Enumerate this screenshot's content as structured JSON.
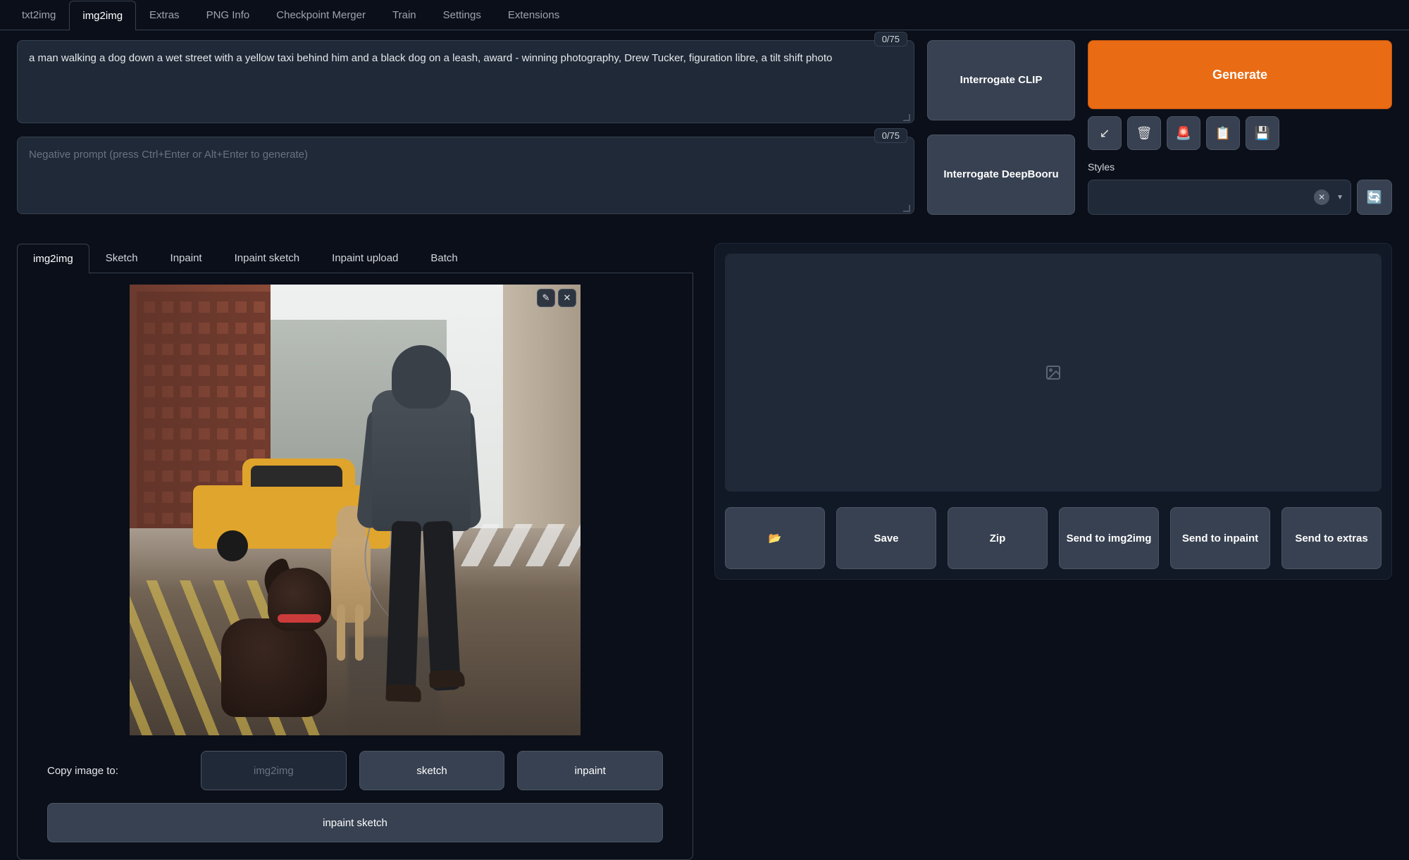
{
  "main_tabs": {
    "txt2img": "txt2img",
    "img2img": "img2img",
    "extras": "Extras",
    "png_info": "PNG Info",
    "checkpoint_merger": "Checkpoint Merger",
    "train": "Train",
    "settings": "Settings",
    "extensions": "Extensions"
  },
  "prompt": {
    "value": "a man walking a dog down a wet street with a yellow taxi behind him and a black dog on a leash, award - winning photography, Drew Tucker, figuration libre, a tilt shift photo",
    "counter": "0/75"
  },
  "neg_prompt": {
    "placeholder": "Negative prompt (press Ctrl+Enter or Alt+Enter to generate)",
    "counter": "0/75"
  },
  "interrogate": {
    "clip": "Interrogate CLIP",
    "deepbooru": "Interrogate DeepBooru"
  },
  "generate": "Generate",
  "toolbar_icons": {
    "resize": "↙",
    "trash": "🗑",
    "siren": "🚨",
    "clipboard": "📋",
    "save": "💾"
  },
  "styles": {
    "label": "Styles",
    "refresh": "🔄"
  },
  "sub_tabs": {
    "img2img": "img2img",
    "sketch": "Sketch",
    "inpaint": "Inpaint",
    "inpaint_sketch": "Inpaint sketch",
    "inpaint_upload": "Inpaint upload",
    "batch": "Batch"
  },
  "image_tools": {
    "edit": "✎",
    "close": "✕"
  },
  "copy": {
    "label": "Copy image to:",
    "img2img": "img2img",
    "sketch": "sketch",
    "inpaint": "inpaint",
    "inpaint_sketch": "inpaint sketch"
  },
  "output": {
    "folder": "📂",
    "save": "Save",
    "zip": "Zip",
    "send_img2img": "Send to img2img",
    "send_inpaint": "Send to inpaint",
    "send_extras": "Send to extras"
  }
}
